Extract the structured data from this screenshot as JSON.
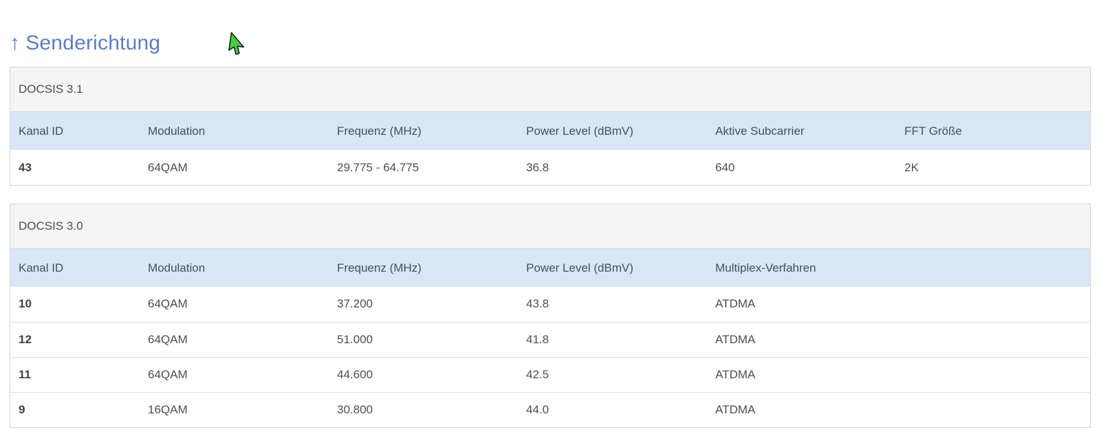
{
  "page": {
    "title_arrow": "↑",
    "title": "Senderichtung"
  },
  "colors": {
    "title_blue": "#5b7ec4",
    "header_row_bg": "#d9e7f4",
    "section_header_bg": "#f5f5f5",
    "card_border": "#d4d4d4",
    "cursor_green": "#3fd23f"
  },
  "cursor": {
    "icon": "green-arrow-pointer"
  },
  "tables": [
    {
      "section_title": "DOCSIS 3.1",
      "headers": [
        "Kanal ID",
        "Modulation",
        "Frequenz (MHz)",
        "Power Level (dBmV)",
        "Aktive Subcarrier",
        "FFT Größe"
      ],
      "rows": [
        [
          "43",
          "64QAM",
          "29.775 - 64.775",
          "36.8",
          "640",
          "2K"
        ]
      ]
    },
    {
      "section_title": "DOCSIS 3.0",
      "headers": [
        "Kanal ID",
        "Modulation",
        "Frequenz (MHz)",
        "Power Level (dBmV)",
        "Multiplex-Verfahren"
      ],
      "rows": [
        [
          "10",
          "64QAM",
          "37.200",
          "43.8",
          "ATDMA"
        ],
        [
          "12",
          "64QAM",
          "51.000",
          "41.8",
          "ATDMA"
        ],
        [
          "11",
          "64QAM",
          "44.600",
          "42.5",
          "ATDMA"
        ],
        [
          "9",
          "16QAM",
          "30.800",
          "44.0",
          "ATDMA"
        ]
      ]
    }
  ]
}
